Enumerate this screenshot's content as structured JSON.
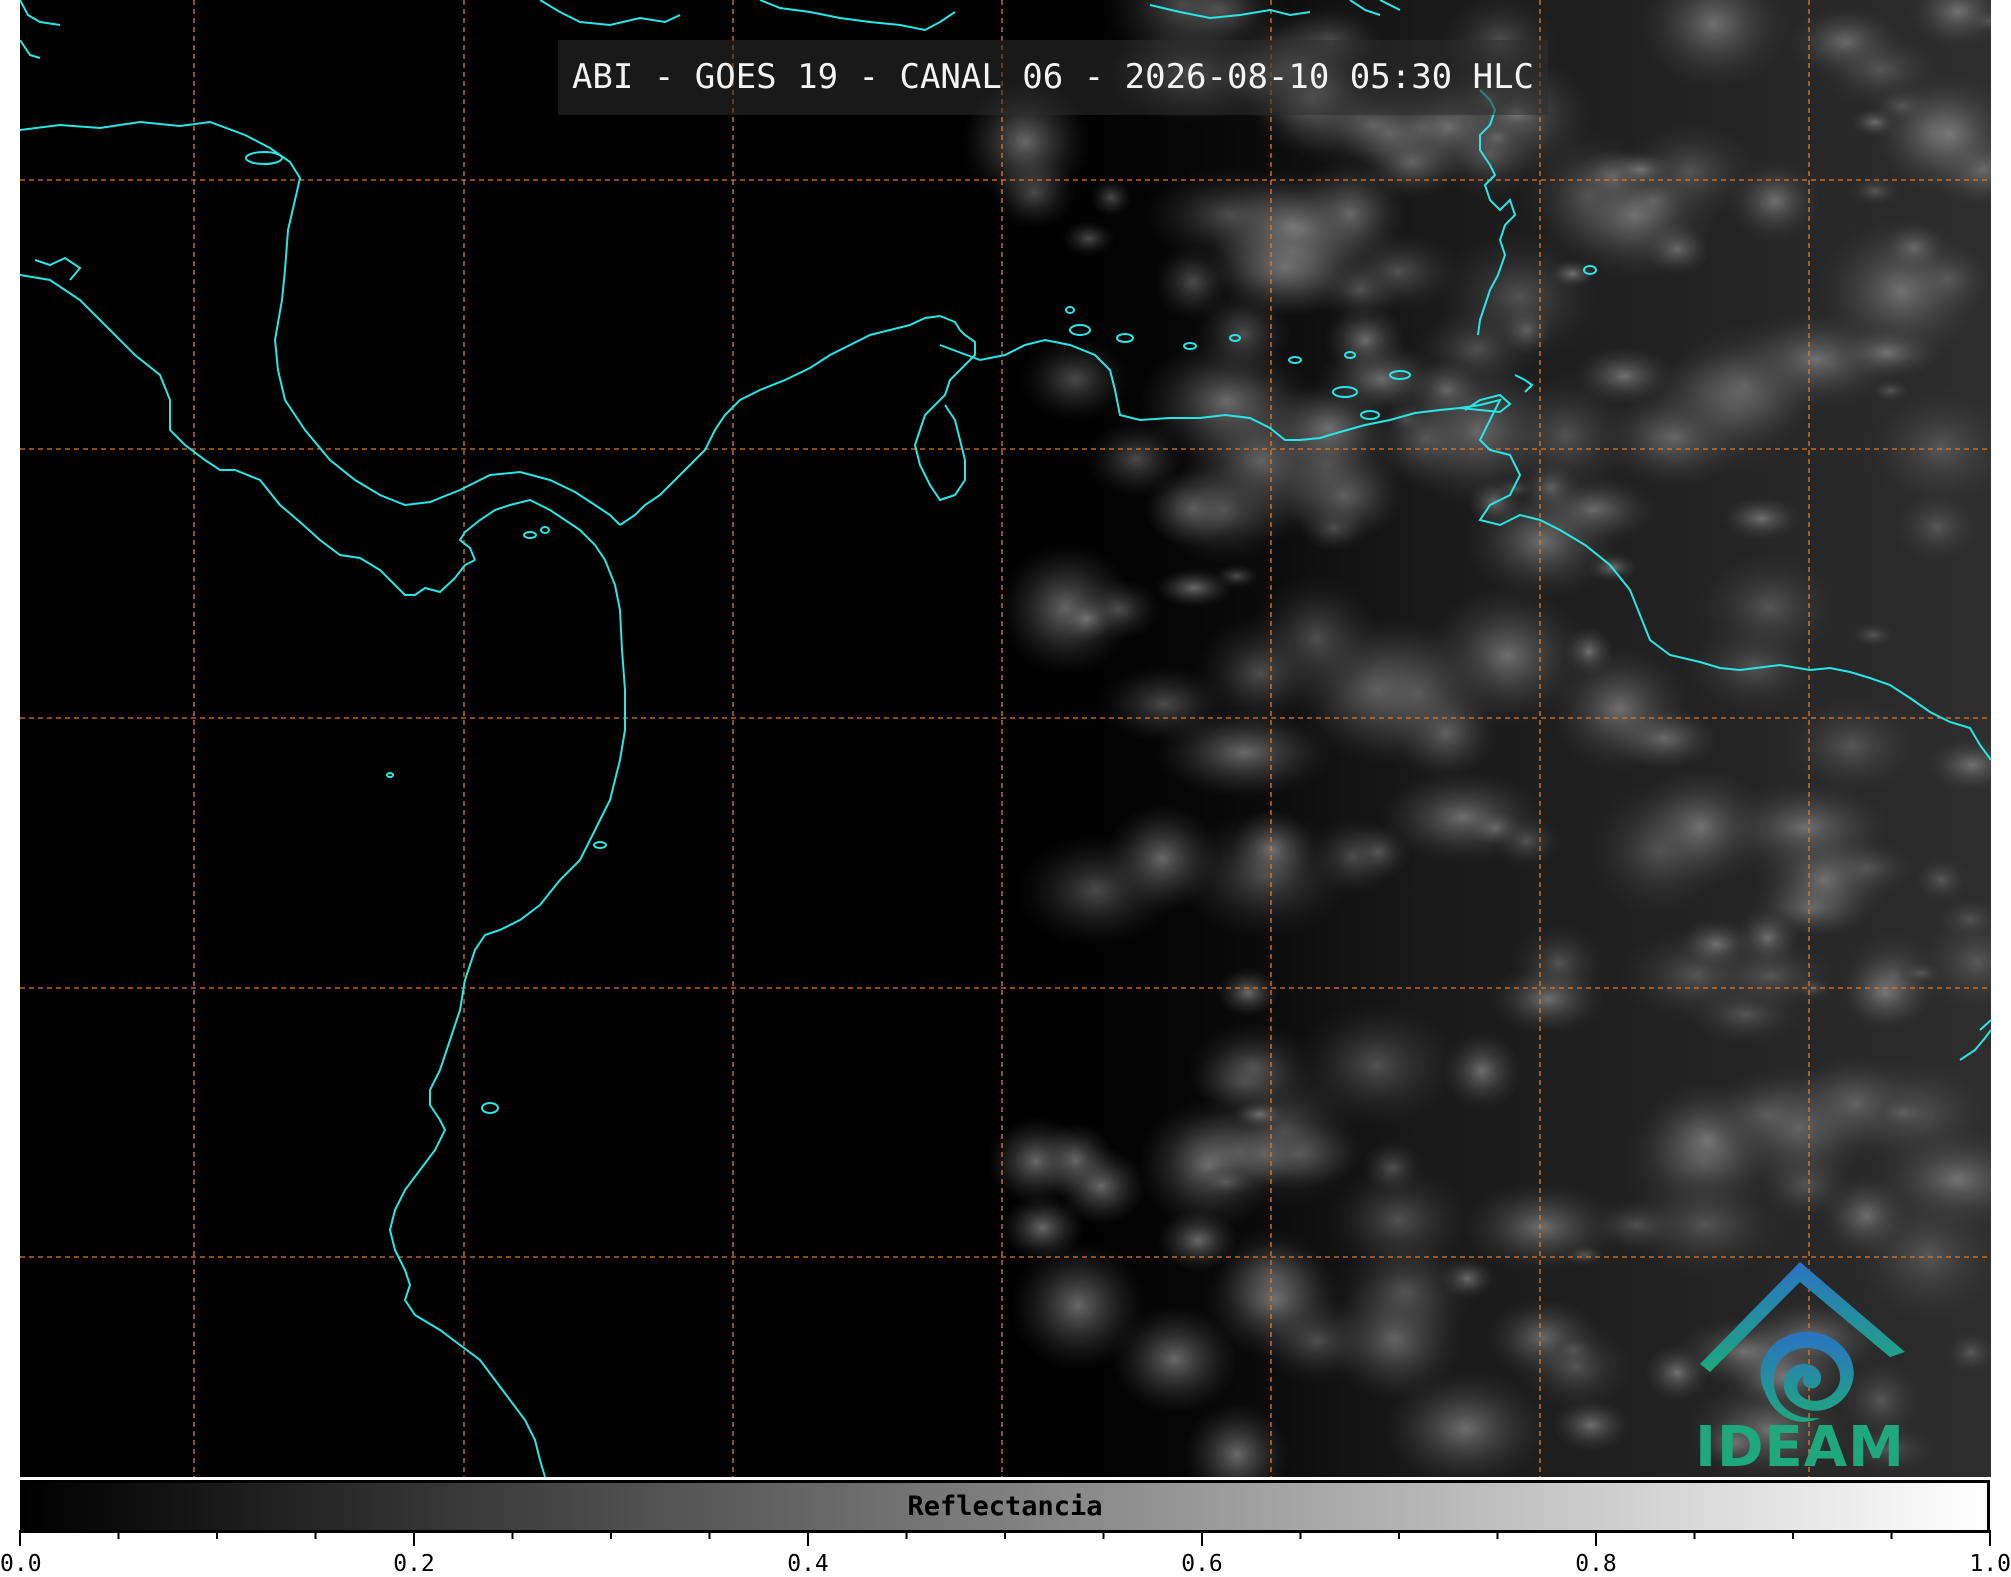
{
  "title": "ABI - GOES 19 - CANAL 06 - 2026-08-10 05:30 HLC",
  "logo": {
    "text": "IDEAM"
  },
  "colorbar": {
    "label": "Reflectancia",
    "ticks": [
      "0.0",
      "0.2",
      "0.4",
      "0.6",
      "0.8",
      "1.0"
    ],
    "range": [
      0.0,
      1.0
    ]
  },
  "colors": {
    "background": "#000000",
    "coastline": "#29e6e6",
    "gridline": "#e07a2a",
    "logo_blue": "#2a73c4",
    "logo_green": "#1fa87c"
  }
}
